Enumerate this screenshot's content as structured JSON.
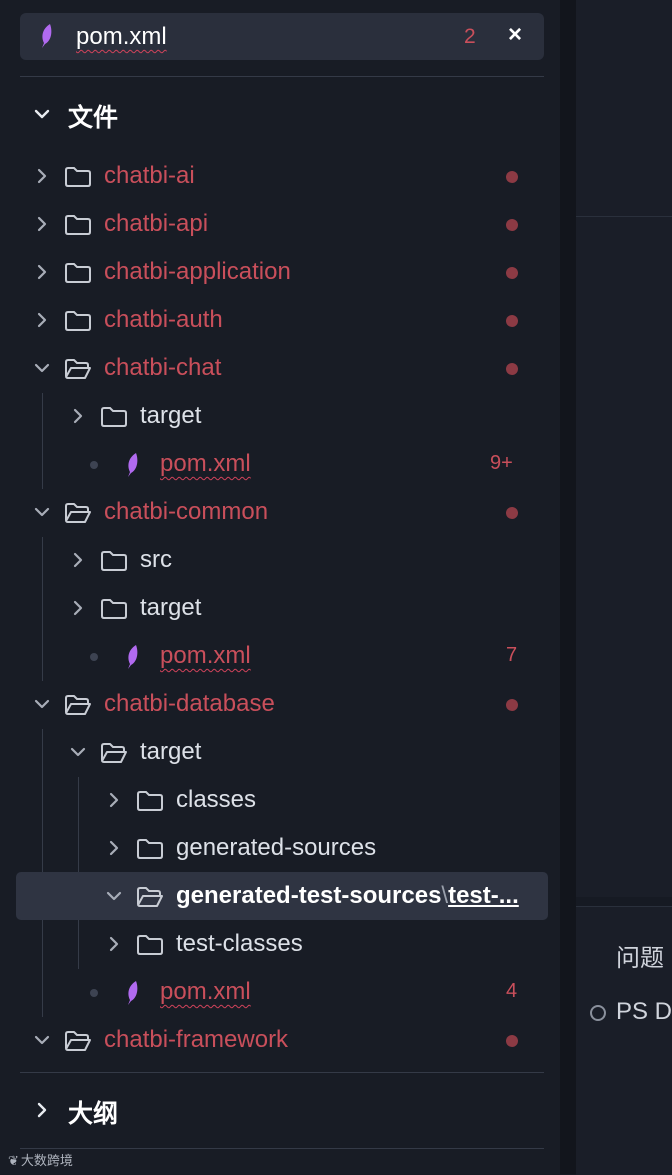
{
  "open_editor": {
    "file_name": "pom.xml",
    "problem_count": "2",
    "close_icon": "×"
  },
  "sections": {
    "files": "文件",
    "outline": "大纲"
  },
  "tree": [
    {
      "label": "chatbi-ai",
      "state": "collapsed",
      "modified": true
    },
    {
      "label": "chatbi-api",
      "state": "collapsed",
      "modified": true
    },
    {
      "label": "chatbi-application",
      "state": "collapsed",
      "modified": true
    },
    {
      "label": "chatbi-auth",
      "state": "collapsed",
      "modified": true
    },
    {
      "label": "chatbi-chat",
      "state": "expanded",
      "modified": true,
      "children": [
        {
          "label": "target",
          "state": "collapsed"
        },
        {
          "label": "pom.xml",
          "type": "file",
          "problems": "9+"
        }
      ]
    },
    {
      "label": "chatbi-common",
      "state": "expanded",
      "modified": true,
      "children": [
        {
          "label": "src",
          "state": "collapsed"
        },
        {
          "label": "target",
          "state": "collapsed"
        },
        {
          "label": "pom.xml",
          "type": "file",
          "problems": "7"
        }
      ]
    },
    {
      "label": "chatbi-database",
      "state": "expanded",
      "modified": true,
      "children": [
        {
          "label": "target",
          "state": "expanded",
          "children": [
            {
              "label": "classes",
              "state": "collapsed"
            },
            {
              "label": "generated-sources",
              "state": "collapsed"
            },
            {
              "label": "generated-test-sources",
              "path_sep": "\\",
              "path_tail": "test-...",
              "state": "expanded",
              "selected": true
            },
            {
              "label": "test-classes",
              "state": "collapsed"
            }
          ]
        },
        {
          "label": "pom.xml",
          "type": "file",
          "problems": "4"
        }
      ]
    },
    {
      "label": "chatbi-framework",
      "state": "expanded",
      "modified": true
    }
  ],
  "right_panel": {
    "tab_label": "问题",
    "terminal_label": "PS D"
  },
  "watermark": {
    "icon": "❦",
    "text": "大数跨境"
  },
  "colors": {
    "error": "#c94f5b",
    "accent_icon": "#b16af0",
    "sidebar_bg": "#181c25"
  }
}
